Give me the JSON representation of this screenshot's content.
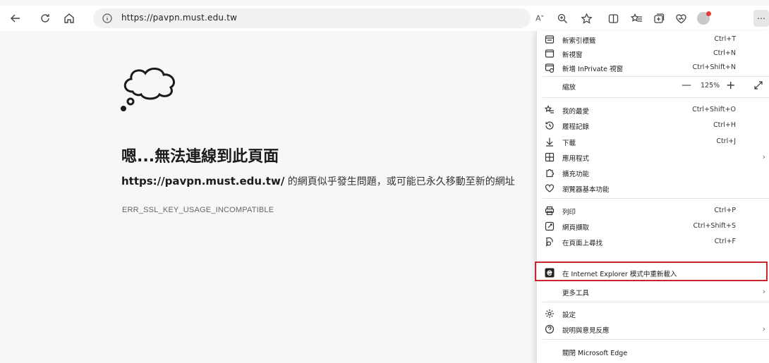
{
  "toolbar": {
    "url": "https://pavpn.must.edu.tw",
    "read_aloud_label": "Áʾ",
    "back_icon": "back-arrow-icon",
    "refresh_icon": "refresh-icon",
    "home_icon": "home-icon"
  },
  "error": {
    "title": "嗯...無法連線到此頁面",
    "url_bold": "https://pavpn.must.edu.tw/",
    "description": " 的網頁似乎發生問題，或可能已永久移動至新的網址",
    "code": "ERR_SSL_KEY_USAGE_INCOMPATIBLE"
  },
  "menu": {
    "items": [
      {
        "label": "新索引標籤",
        "shortcut": "Ctrl+T",
        "icon": "new-tab-icon"
      },
      {
        "label": "新視窗",
        "shortcut": "Ctrl+N",
        "icon": "new-window-icon"
      },
      {
        "label": "新增 InPrivate 視窗",
        "shortcut": "Ctrl+Shift+N",
        "icon": "inprivate-icon"
      },
      {
        "label": "縮放",
        "zoom": "125%"
      },
      {
        "label": "我的最愛",
        "shortcut": "Ctrl+Shift+O",
        "icon": "favorites-icon"
      },
      {
        "label": "履程記錄",
        "shortcut": "Ctrl+H",
        "icon": "history-icon"
      },
      {
        "label": "下載",
        "shortcut": "Ctrl+J",
        "icon": "download-icon"
      },
      {
        "label": "應用程式",
        "shortcut": "",
        "icon": "apps-icon"
      },
      {
        "label": "擴充功能",
        "shortcut": "",
        "icon": "extensions-icon"
      },
      {
        "label": "瀏覽器基本功能",
        "shortcut": "",
        "icon": "browser-essentials-icon"
      },
      {
        "label": "列印",
        "shortcut": "Ctrl+P",
        "icon": "print-icon"
      },
      {
        "label": "網頁擷取",
        "shortcut": "Ctrl+Shift+S",
        "icon": "web-capture-icon"
      },
      {
        "label": "在頁面上尋找",
        "shortcut": "Ctrl+F",
        "icon": "find-icon"
      },
      {
        "label": "在 Internet Explorer 模式中重新載入",
        "shortcut": "",
        "icon": "ie-icon"
      },
      {
        "label": "更多工具",
        "shortcut": ""
      },
      {
        "label": "設定",
        "shortcut": "",
        "icon": "settings-icon"
      },
      {
        "label": "說明與意見反應",
        "shortcut": "",
        "icon": "help-icon"
      },
      {
        "label": "關閉 Microsoft Edge",
        "shortcut": ""
      }
    ]
  },
  "colors": {
    "highlight": "#c8262d",
    "page_bg": "#f7f7f7",
    "menu_bg": "#ffffff"
  }
}
